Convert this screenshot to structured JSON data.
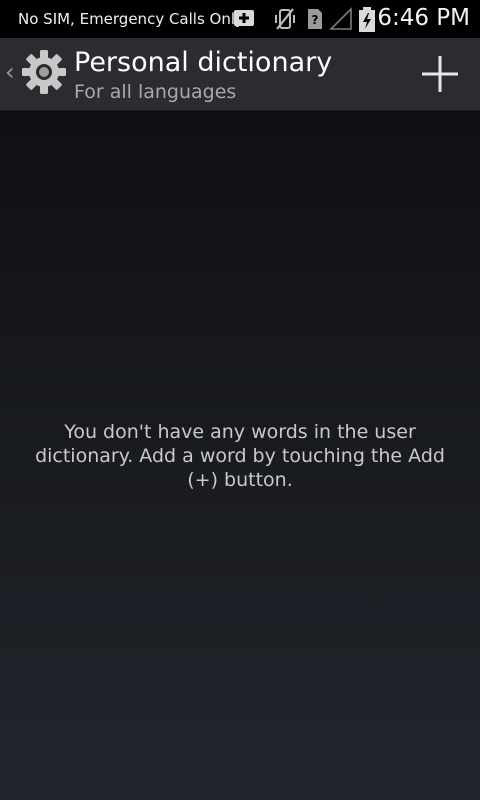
{
  "status_bar": {
    "carrier": "No SIM, Emergency Calls Only",
    "time": "6:46 PM",
    "icons": [
      "sd-card-add-icon",
      "vibrate-off-icon",
      "no-sim-icon",
      "signal-empty-icon",
      "battery-charging-icon"
    ]
  },
  "action_bar": {
    "title": "Personal dictionary",
    "subtitle": "For all languages",
    "app_icon": "gear-icon",
    "add_icon": "plus-icon"
  },
  "main": {
    "empty_message": "You don't have any words in the user dictionary. Add a word by touching the Add (+) button."
  },
  "colors": {
    "status_bar_bg": "#000000",
    "action_bar_bg": "#2b2c2f",
    "text_primary": "#ffffff",
    "text_secondary": "#a9a9a9",
    "empty_text": "#c9c9c9"
  }
}
